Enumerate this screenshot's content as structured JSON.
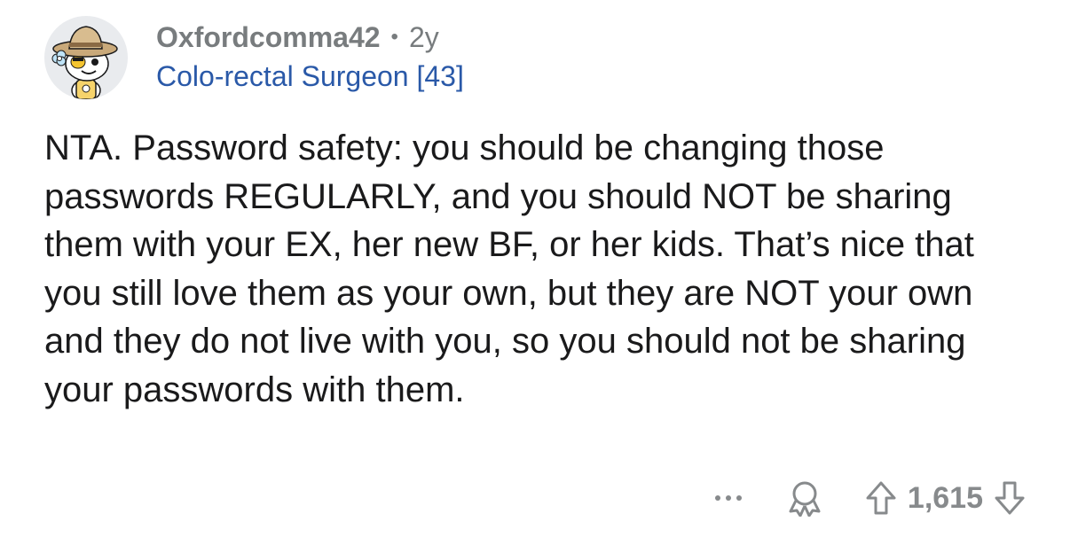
{
  "comment": {
    "username": "Oxfordcomma42",
    "separator": "•",
    "age": "2y",
    "flair": "Colo-rectal Surgeon [43]",
    "body": "NTA. Password safety: you should be changing those passwords REGULARLY, and you should NOT be sharing them with your EX, her new BF, or her kids. That’s nice that you still love them as your own, but they are NOT your own and they do not live with you, so you should not be sharing your passwords with them.",
    "score": "1,615"
  },
  "icons": {
    "avatar": "snoo-avatar",
    "more": "more-options-icon",
    "award": "award-icon",
    "upvote": "upvote-arrow-icon",
    "downvote": "downvote-arrow-icon"
  },
  "colors": {
    "meta_gray": "#787c7e",
    "flair_blue": "#2a59a8",
    "icon_gray": "#878a8c",
    "text": "#1a1a1b"
  }
}
